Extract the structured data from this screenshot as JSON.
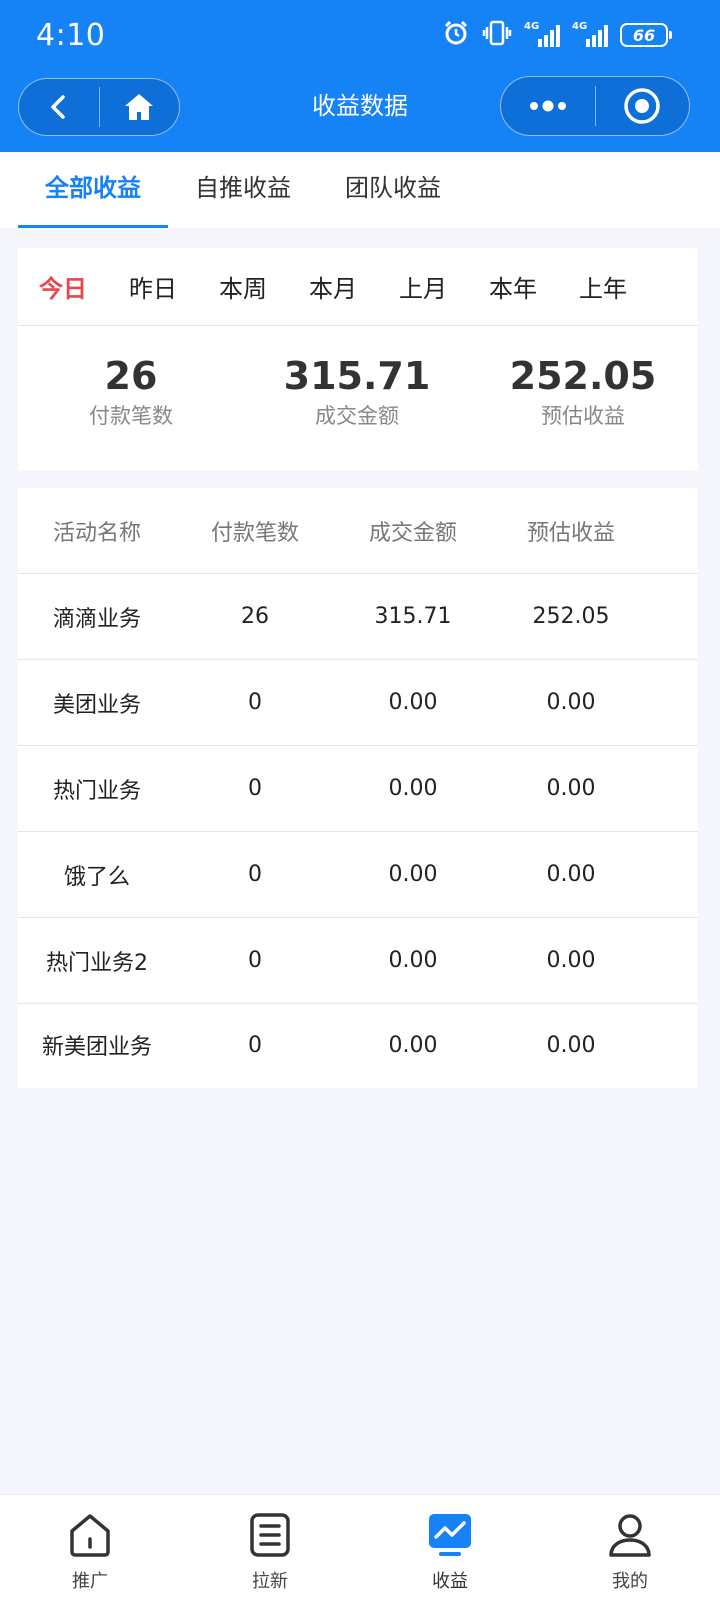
{
  "status_bar": {
    "time": "4:10",
    "battery": "66",
    "signal1": "4G",
    "signal2": "4G"
  },
  "header": {
    "title": "收益数据"
  },
  "tabs": [
    {
      "label": "全部收益",
      "active": true
    },
    {
      "label": "自推收益",
      "active": false
    },
    {
      "label": "团队收益",
      "active": false
    }
  ],
  "periods": [
    {
      "label": "今日",
      "active": true
    },
    {
      "label": "昨日",
      "active": false
    },
    {
      "label": "本周",
      "active": false
    },
    {
      "label": "本月",
      "active": false
    },
    {
      "label": "上月",
      "active": false
    },
    {
      "label": "本年",
      "active": false
    },
    {
      "label": "上年",
      "active": false
    }
  ],
  "summary": [
    {
      "value": "26",
      "label": "付款笔数"
    },
    {
      "value": "315.71",
      "label": "成交金额"
    },
    {
      "value": "252.05",
      "label": "预估收益"
    }
  ],
  "table": {
    "headers": [
      "活动名称",
      "付款笔数",
      "成交金额",
      "预估收益"
    ],
    "rows": [
      [
        "滴滴业务",
        "26",
        "315.71",
        "252.05"
      ],
      [
        "美团业务",
        "0",
        "0.00",
        "0.00"
      ],
      [
        "热门业务",
        "0",
        "0.00",
        "0.00"
      ],
      [
        "饿了么",
        "0",
        "0.00",
        "0.00"
      ],
      [
        "热门业务2",
        "0",
        "0.00",
        "0.00"
      ],
      [
        "新美团业务",
        "0",
        "0.00",
        "0.00"
      ]
    ]
  },
  "bottom_nav": [
    {
      "label": "推广",
      "icon": "home-icon",
      "active": false
    },
    {
      "label": "拉新",
      "icon": "list-icon",
      "active": false
    },
    {
      "label": "收益",
      "icon": "chart-icon",
      "active": true
    },
    {
      "label": "我的",
      "icon": "user-icon",
      "active": false
    }
  ],
  "colors": {
    "primary": "#1582f5",
    "active_period": "#e8474c",
    "background": "#f4f6fc"
  }
}
